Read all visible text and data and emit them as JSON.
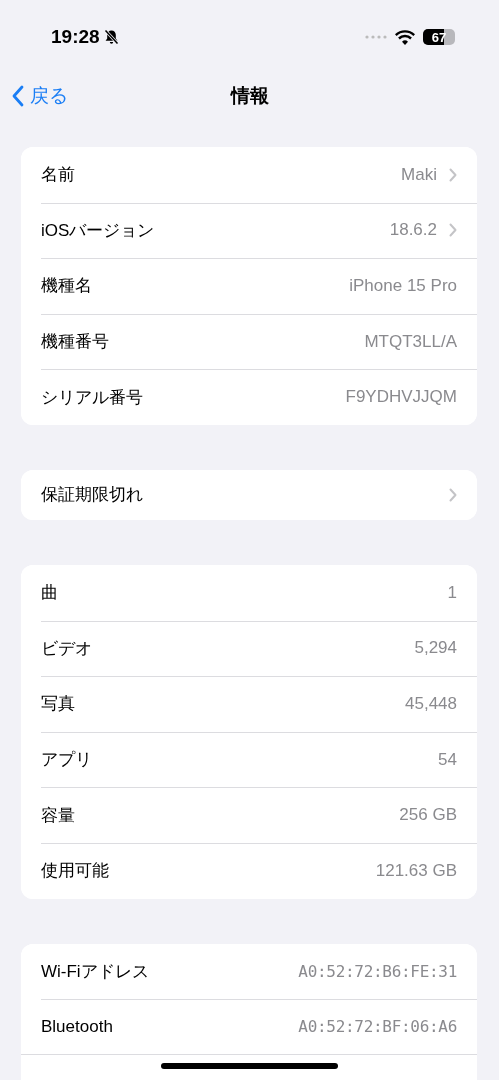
{
  "status_bar": {
    "time": "19:28",
    "battery": "67"
  },
  "nav": {
    "back": "戻る",
    "title": "情報"
  },
  "groups": [
    {
      "rows": [
        {
          "label": "名前",
          "value": "Maki",
          "kind": "link"
        },
        {
          "label": "iOSバージョン",
          "value": "18.6.2",
          "kind": "link"
        },
        {
          "label": "機種名",
          "value": "iPhone 15 Pro",
          "kind": "plain"
        },
        {
          "label": "機種番号",
          "value": "MTQT3LL/A",
          "kind": "plain"
        },
        {
          "label": "シリアル番号",
          "value": "F9YDHVJJQM",
          "kind": "plain"
        }
      ]
    },
    {
      "rows": [
        {
          "label": "保証期限切れ",
          "kind": "link"
        }
      ]
    },
    {
      "rows": [
        {
          "label": "曲",
          "value": "1",
          "kind": "plain"
        },
        {
          "label": "ビデオ",
          "value": "5,294",
          "kind": "plain"
        },
        {
          "label": "写真",
          "value": "45,448",
          "kind": "plain"
        },
        {
          "label": "アプリ",
          "value": "54",
          "kind": "plain"
        },
        {
          "label": "容量",
          "value": "256 GB",
          "kind": "plain"
        },
        {
          "label": "使用可能",
          "value": "121.63 GB",
          "kind": "plain"
        }
      ]
    },
    {
      "rows": [
        {
          "label": "Wi-Fiアドレス",
          "value": "A0:52:72:B6:FE:31",
          "kind": "address"
        },
        {
          "label": "Bluetooth",
          "value": "A0:52:72:BF:06:A6",
          "kind": "address"
        }
      ]
    }
  ]
}
